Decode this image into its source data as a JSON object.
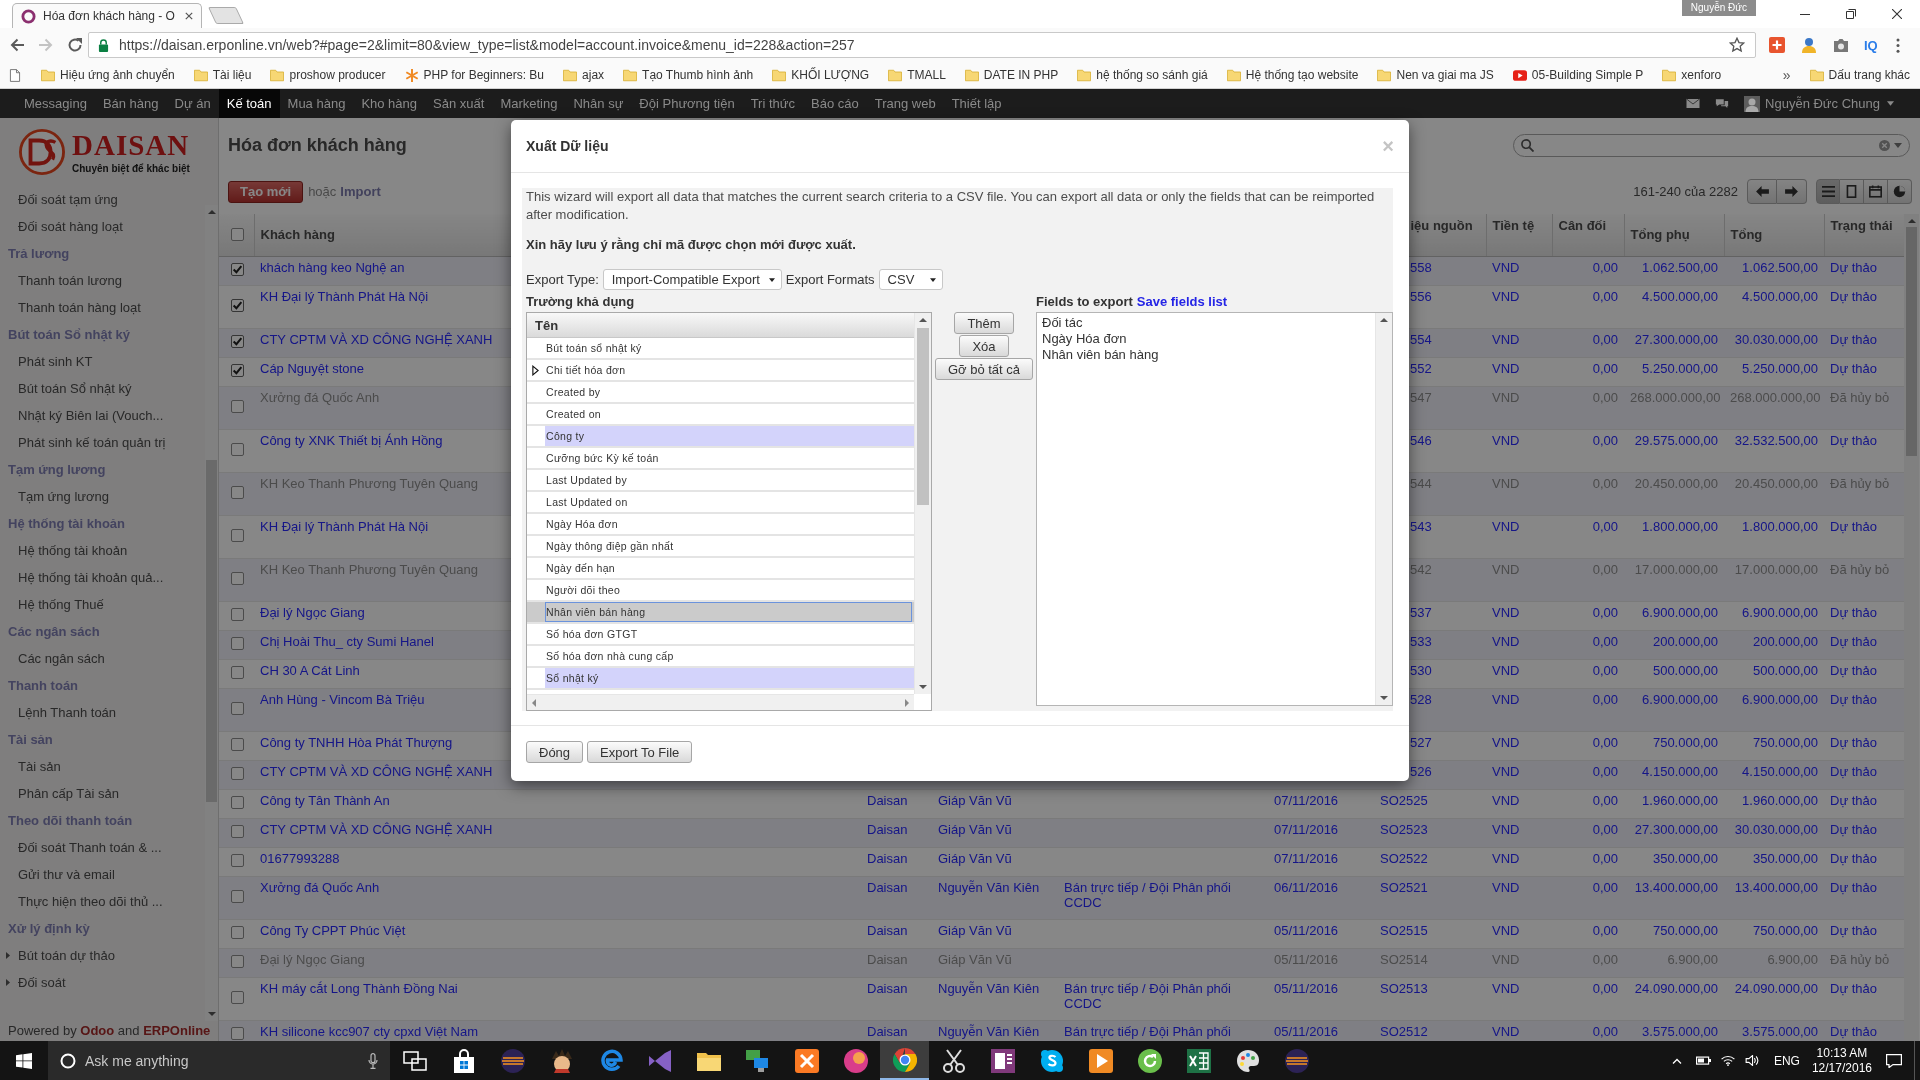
{
  "browser": {
    "tab_title": "Hóa đơn khách hàng - O",
    "profile": "Nguyễn Đức",
    "url": "https://daisan.erponline.vn/web?#page=2&limit=80&view_type=list&model=account.invoice&menu_id=228&action=257",
    "forward_enabled": false,
    "extension_label": "IQ",
    "bookmarks": [
      {
        "label": "Hiệu ứng ảnh chuyển",
        "kind": "folder"
      },
      {
        "label": "Tài liệu",
        "kind": "folder"
      },
      {
        "label": "proshow producer",
        "kind": "folder"
      },
      {
        "label": "PHP for Beginners: Bu",
        "kind": "asterisk"
      },
      {
        "label": "ajax",
        "kind": "folder"
      },
      {
        "label": "Tạo Thumb hình ảnh",
        "kind": "folder"
      },
      {
        "label": "KHỐI LƯỢNG",
        "kind": "folder"
      },
      {
        "label": "TMALL",
        "kind": "folder"
      },
      {
        "label": "DATE IN PHP",
        "kind": "folder"
      },
      {
        "label": "hệ thống so sánh giá",
        "kind": "folder"
      },
      {
        "label": "Hệ thống tạo website",
        "kind": "folder"
      },
      {
        "label": "Nen va giai ma JS",
        "kind": "folder"
      },
      {
        "label": "05-Building Simple P",
        "kind": "video"
      },
      {
        "label": "xenforo",
        "kind": "folder"
      }
    ],
    "overflow": "»",
    "other_bookmarks": "Dấu trang khác"
  },
  "top_menu": {
    "items": [
      {
        "label": "Messaging",
        "selected": false
      },
      {
        "label": "Bán hàng",
        "selected": false
      },
      {
        "label": "Dự án",
        "selected": false
      },
      {
        "label": "Kế toán",
        "selected": true
      },
      {
        "label": "Mua hàng",
        "selected": false
      },
      {
        "label": "Kho hàng",
        "selected": false
      },
      {
        "label": "Sản xuất",
        "selected": false
      },
      {
        "label": "Marketing",
        "selected": false
      },
      {
        "label": "Nhân sự",
        "selected": false
      },
      {
        "label": "Đội Phương tiện",
        "selected": false
      },
      {
        "label": "Tri thức",
        "selected": false
      },
      {
        "label": "Báo cáo",
        "selected": false
      },
      {
        "label": "Trang web",
        "selected": false
      },
      {
        "label": "Thiết lập",
        "selected": false
      }
    ],
    "user": "Nguyễn Đức Chung"
  },
  "sidebar": {
    "brand": "DAISAN",
    "tagline": "Chuyên biệt để khác biệt",
    "groups": [
      {
        "children": [
          {
            "label": "Đối soát tạm ứng",
            "kind": "leaf"
          },
          {
            "label": "Đối soát hàng loạt",
            "kind": "leaf"
          }
        ]
      },
      {
        "label": "Trả lương",
        "children": [
          {
            "label": "Thanh toán lương",
            "kind": "leaf"
          },
          {
            "label": "Thanh toán hàng loạt",
            "kind": "leaf"
          }
        ]
      },
      {
        "label": "Bút toán Sổ nhật ký",
        "children": [
          {
            "label": "Phát sinh KT",
            "kind": "leaf"
          },
          {
            "label": "Bút toán Sổ nhật ký",
            "kind": "leaf"
          },
          {
            "label": "Nhật ký Biên lai (Vouch...",
            "kind": "leaf"
          },
          {
            "label": "Phát sinh kế toán quản trị",
            "kind": "leaf"
          }
        ]
      },
      {
        "label": "Tạm ứng lương",
        "children": [
          {
            "label": "Tạm ứng lương",
            "kind": "leaf"
          }
        ]
      },
      {
        "label": "Hệ thống tài khoản",
        "children": [
          {
            "label": "Hệ thống tài khoản",
            "kind": "leaf"
          },
          {
            "label": "Hệ thống tài khoản quả...",
            "kind": "leaf"
          },
          {
            "label": "Hệ thống Thuế",
            "kind": "leaf"
          }
        ]
      },
      {
        "label": "Các ngân sách",
        "children": [
          {
            "label": "Các ngân sách",
            "kind": "leaf"
          }
        ]
      },
      {
        "label": "Thanh toán",
        "children": [
          {
            "label": "Lệnh Thanh toán",
            "kind": "leaf"
          }
        ]
      },
      {
        "label": "Tài sản",
        "children": [
          {
            "label": "Tài sản",
            "kind": "leaf"
          },
          {
            "label": "Phân cấp Tài sản",
            "kind": "leaf"
          }
        ]
      },
      {
        "label": "Theo dõi thanh toán",
        "children": [
          {
            "label": "Đối soát Thanh toán & ...",
            "kind": "leaf"
          },
          {
            "label": "Gửi thư và email",
            "kind": "leaf"
          },
          {
            "label": "Thực hiện theo dõi thủ ...",
            "kind": "leaf"
          }
        ]
      },
      {
        "label": "Xử lý định kỳ",
        "children": [
          {
            "label": "Bút toán dự thảo",
            "kind": "folder"
          },
          {
            "label": "Đối soát",
            "kind": "folder"
          }
        ]
      }
    ],
    "footer": "Powered by **Odoo** and **ERPOnline**"
  },
  "list_view": {
    "title": "Hóa đơn khách hàng",
    "create_button": "Tạo mới",
    "or_text": "hoặc",
    "import_link": "Import",
    "pager": "161-240 của 2282",
    "views": [
      {
        "kind": "list",
        "selected": true
      },
      {
        "kind": "form",
        "selected": false
      },
      {
        "kind": "calendar",
        "selected": false
      },
      {
        "kind": "graph",
        "selected": false
      }
    ]
  },
  "table": {
    "select_all": false,
    "columns": {
      "customer": "Khách hàng",
      "source": "iệu nguồn",
      "currency": "Tiền tệ",
      "balance": "Cân đối",
      "subtotal": "Tổng phụ",
      "total": "Tổng",
      "status": "Trạng thái"
    },
    "rows": [
      {
        "checked": true,
        "cancelled": false,
        "tall": false,
        "customer": "khách hàng keo Nghệ an",
        "source": "558",
        "currency": "VND",
        "balance": "0,00",
        "subtotal": "1.062.500,00",
        "total": "1.062.500,00",
        "status": "Dự thảo"
      },
      {
        "checked": true,
        "cancelled": false,
        "tall": true,
        "customer": "KH Đại lý Thành Phát Hà Nội",
        "source": "556",
        "currency": "VND",
        "balance": "0,00",
        "subtotal": "4.500.000,00",
        "total": "4.500.000,00",
        "status": "Dự thảo"
      },
      {
        "checked": true,
        "cancelled": false,
        "tall": false,
        "customer": "CTY CPTM VÀ XD CÔNG NGHỆ XANH",
        "source": "554",
        "currency": "VND",
        "balance": "0,00",
        "subtotal": "27.300.000,00",
        "total": "30.030.000,00",
        "status": "Dự thảo"
      },
      {
        "checked": true,
        "cancelled": false,
        "tall": false,
        "customer": "Cáp Nguyệt stone",
        "source": "552",
        "currency": "VND",
        "balance": "0,00",
        "subtotal": "5.250.000,00",
        "total": "5.250.000,00",
        "status": "Dự thảo"
      },
      {
        "checked": false,
        "cancelled": true,
        "tall": true,
        "customer": "Xưởng đá Quốc Anh",
        "source": "547",
        "currency": "VND",
        "balance": "0,00",
        "subtotal": "268.000.000,00",
        "total": "268.000.000,00",
        "status": "Đã hủy bỏ"
      },
      {
        "checked": false,
        "cancelled": false,
        "tall": true,
        "customer": "Công ty XNK Thiết bị Ánh Hồng",
        "source": "546",
        "currency": "VND",
        "balance": "0,00",
        "subtotal": "29.575.000,00",
        "total": "32.532.500,00",
        "status": "Dự thảo"
      },
      {
        "checked": false,
        "cancelled": true,
        "tall": true,
        "customer": "KH Keo Thanh Phương Tuyên Quang",
        "source": "544",
        "currency": "VND",
        "balance": "0,00",
        "subtotal": "20.450.000,00",
        "total": "20.450.000,00",
        "status": "Đã hủy bỏ"
      },
      {
        "checked": false,
        "cancelled": false,
        "tall": true,
        "customer": "KH Đại lý Thành Phát Hà Nội",
        "source": "543",
        "currency": "VND",
        "balance": "0,00",
        "subtotal": "1.800.000,00",
        "total": "1.800.000,00",
        "status": "Dự thảo"
      },
      {
        "checked": false,
        "cancelled": true,
        "tall": true,
        "customer": "KH Keo Thanh Phương Tuyên Quang",
        "source": "542",
        "currency": "VND",
        "balance": "0,00",
        "subtotal": "17.000.000,00",
        "total": "17.000.000,00",
        "status": "Đã hủy bỏ"
      },
      {
        "checked": false,
        "cancelled": false,
        "tall": false,
        "customer": "Đại lý Ngọc Giang",
        "source": "537",
        "currency": "VND",
        "balance": "0,00",
        "subtotal": "6.900.000,00",
        "total": "6.900.000,00",
        "status": "Dự thảo"
      },
      {
        "checked": false,
        "cancelled": false,
        "tall": false,
        "customer": "Chị Hoài Thu_ cty Sumi Hanel",
        "source": "533",
        "currency": "VND",
        "balance": "0,00",
        "subtotal": "200.000,00",
        "total": "200.000,00",
        "status": "Dự thảo"
      },
      {
        "checked": false,
        "cancelled": false,
        "tall": false,
        "customer": "CH 30 A Cát Linh",
        "source": "530",
        "currency": "VND",
        "balance": "0,00",
        "subtotal": "500.000,00",
        "total": "500.000,00",
        "status": "Dự thảo"
      },
      {
        "checked": false,
        "cancelled": false,
        "tall": true,
        "customer": "Anh Hùng - Vincom Bà Triệu",
        "source": "528",
        "currency": "VND",
        "balance": "0,00",
        "subtotal": "6.900.000,00",
        "total": "6.900.000,00",
        "status": "Dự thảo"
      },
      {
        "checked": false,
        "cancelled": false,
        "tall": false,
        "customer": "Công ty TNHH Hòa Phát Thượng",
        "source": "527",
        "currency": "VND",
        "balance": "0,00",
        "subtotal": "750.000,00",
        "total": "750.000,00",
        "status": "Dự thảo"
      },
      {
        "checked": false,
        "cancelled": false,
        "tall": false,
        "customer": "CTY CPTM VÀ XD CÔNG NGHỆ XANH",
        "source": "526",
        "currency": "VND",
        "balance": "0,00",
        "subtotal": "4.150.000,00",
        "total": "4.150.000,00",
        "status": "Dự thảo"
      },
      {
        "checked": false,
        "cancelled": false,
        "tall": false,
        "customer": "Công ty Tân Thành An",
        "company": "Daisan",
        "salesperson": "Giáp Văn Vũ",
        "date": "07/11/2016",
        "source": "SO2525",
        "currency": "VND",
        "balance": "0,00",
        "subtotal": "1.960.000,00",
        "total": "1.960.000,00",
        "status": "Dự thảo"
      },
      {
        "checked": false,
        "cancelled": false,
        "tall": false,
        "customer": "CTY CPTM VÀ XD CÔNG NGHỆ XANH",
        "company": "Daisan",
        "salesperson": "Giáp Văn Vũ",
        "date": "07/11/2016",
        "source": "SO2523",
        "currency": "VND",
        "balance": "0,00",
        "subtotal": "27.300.000,00",
        "total": "30.030.000,00",
        "status": "Dự thảo"
      },
      {
        "checked": false,
        "cancelled": false,
        "tall": false,
        "customer": "01677993288",
        "company": "Daisan",
        "salesperson": "Giáp Văn Vũ",
        "date": "07/11/2016",
        "source": "SO2522",
        "currency": "VND",
        "balance": "0,00",
        "subtotal": "350.000,00",
        "total": "350.000,00",
        "status": "Dự thảo"
      },
      {
        "checked": false,
        "cancelled": false,
        "customer": "Xưởng đá Quốc Anh",
        "company": "Daisan",
        "salesperson": "Nguyễn Văn Kiên",
        "sales_team": "Bán trực tiếp / Đội Phân phối CCDC",
        "date": "06/11/2016",
        "source": "SO2521",
        "currency": "VND",
        "balance": "0,00",
        "subtotal": "13.400.000,00",
        "total": "13.400.000,00",
        "status": "Dự thảo"
      },
      {
        "checked": false,
        "cancelled": false,
        "tall": false,
        "customer": "Công Ty CPPT Phúc Việt",
        "company": "Daisan",
        "salesperson": "Giáp Văn Vũ",
        "date": "05/11/2016",
        "source": "SO2515",
        "currency": "VND",
        "balance": "0,00",
        "subtotal": "750.000,00",
        "total": "750.000,00",
        "status": "Dự thảo"
      },
      {
        "checked": false,
        "cancelled": true,
        "tall": false,
        "customer": "Đại lý Ngọc Giang",
        "company": "Daisan",
        "salesperson": "Giáp Văn Vũ",
        "date": "05/11/2016",
        "source": "SO2514",
        "currency": "VND",
        "balance": "0,00",
        "subtotal": "6.900,00",
        "total": "6.900,00",
        "status": "Đã hủy bỏ"
      },
      {
        "checked": false,
        "cancelled": false,
        "customer": "KH máy cắt Long Thành Đồng Nai",
        "company": "Daisan",
        "salesperson": "Nguyễn Văn Kiên",
        "sales_team": "Bán trực tiếp / Đội Phân phối CCDC",
        "date": "05/11/2016",
        "source": "SO2513",
        "currency": "VND",
        "balance": "0,00",
        "subtotal": "24.090.000,00",
        "total": "24.090.000,00",
        "status": "Dự thảo"
      },
      {
        "checked": false,
        "cancelled": false,
        "tall": false,
        "customer": "KH silicone kcc907 cty cpxd Việt Nam",
        "company": "Daisan",
        "salesperson": "Nguyễn Văn Kiên",
        "sales_team": "Bán trực tiếp / Đội Phân phối",
        "date": "05/11/2016",
        "source": "SO2512",
        "currency": "VND",
        "balance": "0,00",
        "subtotal": "3.575.000,00",
        "total": "3.575.000,00",
        "status": "Dự thảo"
      }
    ]
  },
  "export_dialog": {
    "title": "Xuất Dữ liệu",
    "close": "×",
    "intro": "This wizard will export all data that matches the current search criteria to a CSV file. You can export all data or only the fields that can be reimported after modification.",
    "note": "Xin hãy lưu ý rằng chỉ mã được chọn mới được xuất.",
    "export_type_label": "Export Type:",
    "export_type": "Import-Compatible Export",
    "formats_label": "Export Formats",
    "format": "CSV",
    "available_label": "Trường khả dụng",
    "list_header": "Tên",
    "available_fields": [
      {
        "label": "Bút toán sổ nhật ký",
        "kind": "field",
        "required": false,
        "selected": false
      },
      {
        "label": "Chi tiết hóa đơn",
        "kind": "group",
        "required": false,
        "selected": false
      },
      {
        "label": "Created by",
        "kind": "field",
        "required": false,
        "selected": false
      },
      {
        "label": "Created on",
        "kind": "field",
        "required": false,
        "selected": false
      },
      {
        "label": "Công ty",
        "kind": "field",
        "required": true,
        "selected": false
      },
      {
        "label": "Cưỡng bức Kỳ kế toán",
        "kind": "field",
        "required": false,
        "selected": false
      },
      {
        "label": "Last Updated by",
        "kind": "field",
        "required": false,
        "selected": false
      },
      {
        "label": "Last Updated on",
        "kind": "field",
        "required": false,
        "selected": false
      },
      {
        "label": "Ngày Hóa đơn",
        "kind": "field",
        "required": false,
        "selected": false
      },
      {
        "label": "Ngày thông điệp gần nhất",
        "kind": "field",
        "required": false,
        "selected": false
      },
      {
        "label": "Ngày đến hạn",
        "kind": "field",
        "required": false,
        "selected": false
      },
      {
        "label": "Người dõi theo",
        "kind": "field",
        "required": false,
        "selected": false
      },
      {
        "label": "Nhân viên bán hàng",
        "kind": "field",
        "required": false,
        "selected": true
      },
      {
        "label": "Số hóa đơn GTGT",
        "kind": "field",
        "required": false,
        "selected": false
      },
      {
        "label": "Số hóa đơn nhà cung cấp",
        "kind": "field",
        "required": false,
        "selected": false
      },
      {
        "label": "Sổ nhật ký",
        "kind": "field",
        "required": true,
        "selected": false
      }
    ],
    "add_button": "Thêm",
    "remove_button": "Xóa",
    "remove_all_button": "Gỡ bỏ tất cả",
    "export_label": "Fields to export",
    "save_link": "Save fields list",
    "export_fields": [
      "Đối tác",
      "Ngày Hóa đơn",
      "Nhân viên bán hàng"
    ],
    "buttons": [
      "Đóng",
      "Export To File"
    ]
  },
  "taskbar": {
    "search_placeholder": "Ask me anything",
    "apps": [
      {
        "kind": "task_view",
        "selected": false
      },
      {
        "kind": "store",
        "selected": false
      },
      {
        "kind": "sphere",
        "selected": false
      },
      {
        "kind": "character",
        "selected": false
      },
      {
        "kind": "edge",
        "selected": false
      },
      {
        "kind": "bowtie",
        "selected": false
      },
      {
        "kind": "folder",
        "selected": false
      },
      {
        "kind": "monitors",
        "selected": false
      },
      {
        "kind": "xampp",
        "selected": false
      },
      {
        "kind": "orb",
        "selected": false
      },
      {
        "kind": "chrome",
        "selected": true
      },
      {
        "kind": "scissors",
        "selected": false
      },
      {
        "kind": "notebook",
        "selected": false
      },
      {
        "kind": "bubble",
        "selected": false
      },
      {
        "kind": "media",
        "selected": false
      },
      {
        "kind": "refresh",
        "selected": false
      },
      {
        "kind": "sheet",
        "selected": false
      },
      {
        "kind": "palette",
        "selected": false
      },
      {
        "kind": "sphere",
        "selected": false
      }
    ],
    "language": "ENG",
    "time": "10:13 AM",
    "date": "12/17/2016"
  }
}
